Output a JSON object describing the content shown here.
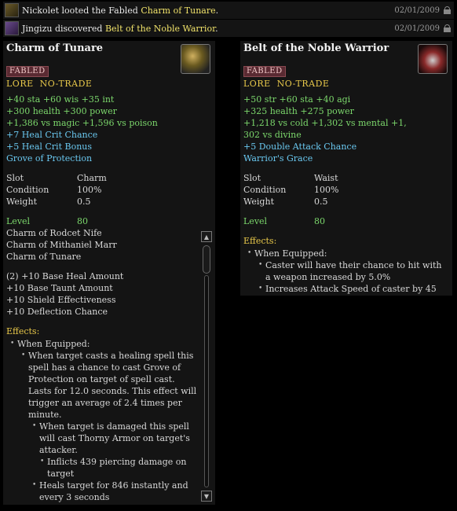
{
  "feed": [
    {
      "player": "Nickolet",
      "verb": " looted the Fabled ",
      "item": "Charm of Tunare",
      "tail": ".",
      "date": "02/01/2009"
    },
    {
      "player": "Jingizu",
      "verb": " discovered ",
      "item": "Belt of the Noble Warrior",
      "tail": ".",
      "date": "02/01/2009"
    }
  ],
  "left": {
    "title": "Charm of Tunare",
    "badge": "FABLED",
    "flags": [
      "LORE",
      "NO-TRADE"
    ],
    "stats": [
      "+40 sta  +60 wis  +35 int",
      "+300 health  +300 power",
      "+1,386 vs magic  +1,596 vs poison"
    ],
    "bonuses": [
      "+7 Heal Crit Chance",
      "+5 Heal Crit Bonus",
      "Grove of Protection"
    ],
    "slot_label": "Slot",
    "slot": "Charm",
    "condition_label": "Condition",
    "condition": "100%",
    "weight_label": "Weight",
    "weight": "0.5",
    "level_label": "Level",
    "level": "80",
    "set_items": [
      "Charm of Rodcet Nife",
      "Charm of Mithaniel Marr",
      "Charm of Tunare"
    ],
    "set_bonus": [
      "(2)  +10 Base Heal Amount",
      "+10 Base Taunt Amount",
      "+10 Shield Effectiveness",
      "+10 Deflection Chance"
    ],
    "effects_label": "Effects:",
    "when_equipped": "When Equipped:",
    "effect1": "When target casts a healing spell this spell has a chance to cast Grove of Protection on target of spell cast.  Lasts for 12.0 seconds.  This effect will trigger an average of 2.4 times per minute.",
    "effect2": "When target is damaged this spell will cast Thorny Armor on target's attacker.",
    "effect3": "Inflicts 439 piercing damage on target",
    "effect4": "Heals target for 846 instantly and every 3 seconds"
  },
  "right": {
    "title": "Belt of the Noble Warrior",
    "badge": "FABLED",
    "flags": [
      "LORE",
      "NO-TRADE"
    ],
    "stats": [
      "+50 str  +60 sta  +40 agi",
      "+325 health  +275 power",
      "+1,218 vs cold  +1,302 vs mental  +1,",
      "302 vs divine"
    ],
    "bonuses": [
      "+5 Double Attack Chance",
      "Warrior's Grace"
    ],
    "slot_label": "Slot",
    "slot": "Waist",
    "condition_label": "Condition",
    "condition": "100%",
    "weight_label": "Weight",
    "weight": "0.5",
    "level_label": "Level",
    "level": "80",
    "effects_label": "Effects:",
    "when_equipped": "When Equipped:",
    "effect1": "Caster will have their chance to hit with a weapon increased by 5.0%",
    "effect2": "Increases Attack Speed of caster by 45"
  },
  "icons": {
    "feed1": "loot-bag-icon",
    "feed2": "discovery-scroll-icon",
    "lock": "lock-icon",
    "charm": "charm-item-icon",
    "belt": "belt-item-icon"
  }
}
